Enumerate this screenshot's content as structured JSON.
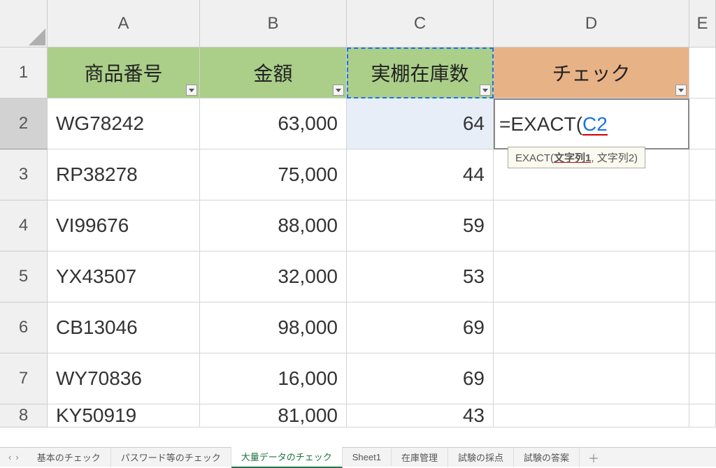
{
  "columns": [
    "A",
    "B",
    "C",
    "D",
    "E"
  ],
  "row_numbers": [
    1,
    2,
    3,
    4,
    5,
    6,
    7,
    8
  ],
  "headers": {
    "a": "商品番号",
    "b": "金額",
    "c": "実棚在庫数",
    "d": "チェック"
  },
  "formula": {
    "prefix": "=",
    "fn": "EXACT",
    "open": "(",
    "ref": "C2"
  },
  "tooltip": {
    "fn": "EXACT(",
    "arg1": "文字列1",
    "sep": ", ",
    "arg2": "文字列2)",
    "full": "EXACT(文字列1, 文字列2)"
  },
  "rows": [
    {
      "a": "WG78242",
      "b": "63,000",
      "c": "64"
    },
    {
      "a": "RP38278",
      "b": "75,000",
      "c": "44"
    },
    {
      "a": "VI99676",
      "b": "88,000",
      "c": "59"
    },
    {
      "a": "YX43507",
      "b": "32,000",
      "c": "53"
    },
    {
      "a": "CB13046",
      "b": "98,000",
      "c": "69"
    },
    {
      "a": "WY70836",
      "b": "16,000",
      "c": "69"
    },
    {
      "a": "KY50919",
      "b": "81,000",
      "c": "43"
    }
  ],
  "tabs": {
    "items": [
      "基本のチェック",
      "パスワード等のチェック",
      "大量データのチェック",
      "Sheet1",
      "在庫管理",
      "試験の採点",
      "試験の答案"
    ],
    "active_index": 2,
    "add": "＋"
  },
  "nav": {
    "prev": "‹",
    "next": "›"
  }
}
